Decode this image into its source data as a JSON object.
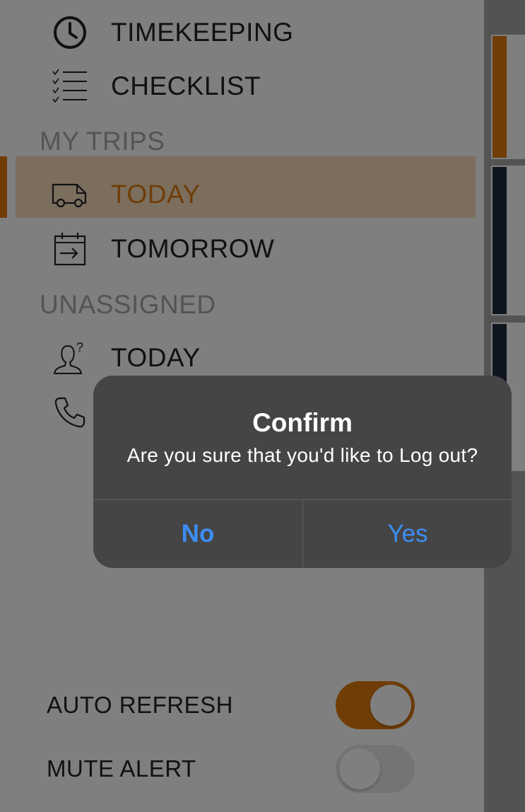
{
  "menu": {
    "timekeeping": "TIMEKEEPING",
    "checklist": "CHECKLIST",
    "my_trips_header": "MY TRIPS",
    "my_trips_today": "TODAY",
    "my_trips_tomorrow": "TOMORROW",
    "unassigned_header": "UNASSIGNED",
    "unassigned_today": "TODAY"
  },
  "settings": {
    "auto_refresh_label": "AUTO REFRESH",
    "auto_refresh_on": true,
    "mute_alert_label": "MUTE ALERT",
    "mute_alert_on": false
  },
  "dialog": {
    "title": "Confirm",
    "message": "Are you sure that you'd like to Log out?",
    "no_label": "No",
    "yes_label": "Yes"
  },
  "colors": {
    "accent": "#e07b0f",
    "selected_bg": "#f7dcbb",
    "dialog_button": "#3d8df5",
    "card_stripe_dark": "#1f2b3d"
  },
  "icons": {
    "timekeeping": "clock-icon",
    "checklist": "checklist-icon",
    "today": "van-icon",
    "tomorrow": "calendar-arrow-icon",
    "unassigned": "person-question-icon",
    "call": "phone-icon"
  }
}
